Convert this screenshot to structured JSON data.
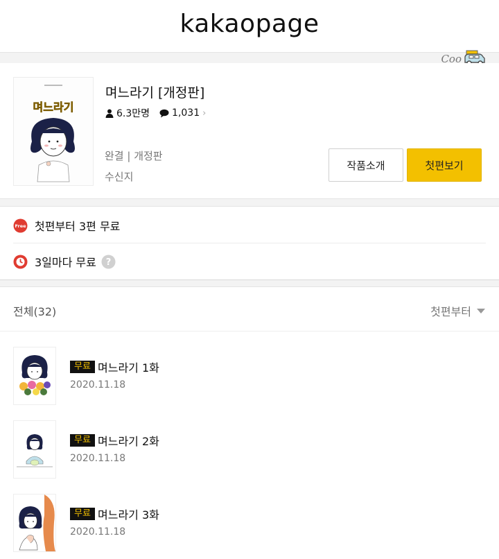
{
  "header": {
    "logo": "kakaopage"
  },
  "watermark": {
    "text": "Coo"
  },
  "work": {
    "title": "며느라기 [개정판]",
    "views": "6.3만명",
    "comments": "1,031",
    "status": "완결 | 개정판",
    "author": "수신지",
    "cover_title": "며느라기",
    "intro_button": "작품소개",
    "first_episode_button": "첫편보기"
  },
  "promos": {
    "free_badge": "Free",
    "free_first": "첫편부터 3편 무료",
    "wait_free": "3일마다 무료"
  },
  "list": {
    "total": "전체(32)",
    "sort": "첫편부터",
    "episodes": [
      {
        "badge": "무료",
        "title": "며느라기 1화",
        "date": "2020.11.18"
      },
      {
        "badge": "무료",
        "title": "며느라기 2화",
        "date": "2020.11.18"
      },
      {
        "badge": "무료",
        "title": "며느라기 3화",
        "date": "2020.11.18"
      }
    ]
  },
  "colors": {
    "accent_yellow": "#f3c000",
    "free_red": "#e03c31"
  }
}
